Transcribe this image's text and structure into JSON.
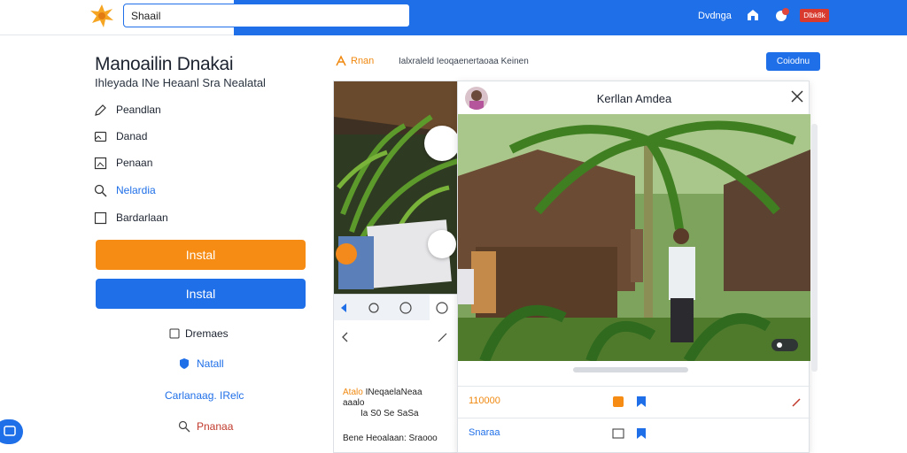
{
  "header": {
    "search_value": "Shaail",
    "link_label": "Dvdnga",
    "badge_label": "Dlbk8k"
  },
  "left": {
    "title": "Manoailin Dnakai",
    "subtitle": "Ihleyada INe Heaanl Sra Nealatal",
    "menu": [
      {
        "label": "Peandlan",
        "icon": "pen-icon"
      },
      {
        "label": "Danad",
        "icon": "image-icon"
      },
      {
        "label": "Penaan",
        "icon": "frame-icon"
      },
      {
        "label": "Nelardia",
        "icon": "search-icon"
      },
      {
        "label": "Bardarlaan",
        "icon": "square-icon"
      }
    ],
    "install_orange_label": "Instal",
    "install_blue_label": "Instal",
    "option_1": "Dremaes",
    "option_2": "Natall",
    "option_3": "Carlanaag. IRelc",
    "option_4": "Pnanaa"
  },
  "share": {
    "label": "Rnan",
    "description": "Ialxraleld Ieoqaenertaoaa Keinen",
    "tool_button": "Coiodnu"
  },
  "gallery": {
    "caption_highlight": "Atalo",
    "caption_line1": "INeqaelaNeaa",
    "caption_line2": "aaalo",
    "caption_line3": "Ia S0 Se SaSa",
    "footer": "Bene Heoalaan: Sraooo"
  },
  "viewer": {
    "title": "Kerllan Amdea",
    "row1_label": "110000",
    "row2_label": "Snaraa"
  },
  "colors": {
    "primary": "#1f6fe8",
    "accent": "#f78c14",
    "badge": "#d83b2e"
  }
}
